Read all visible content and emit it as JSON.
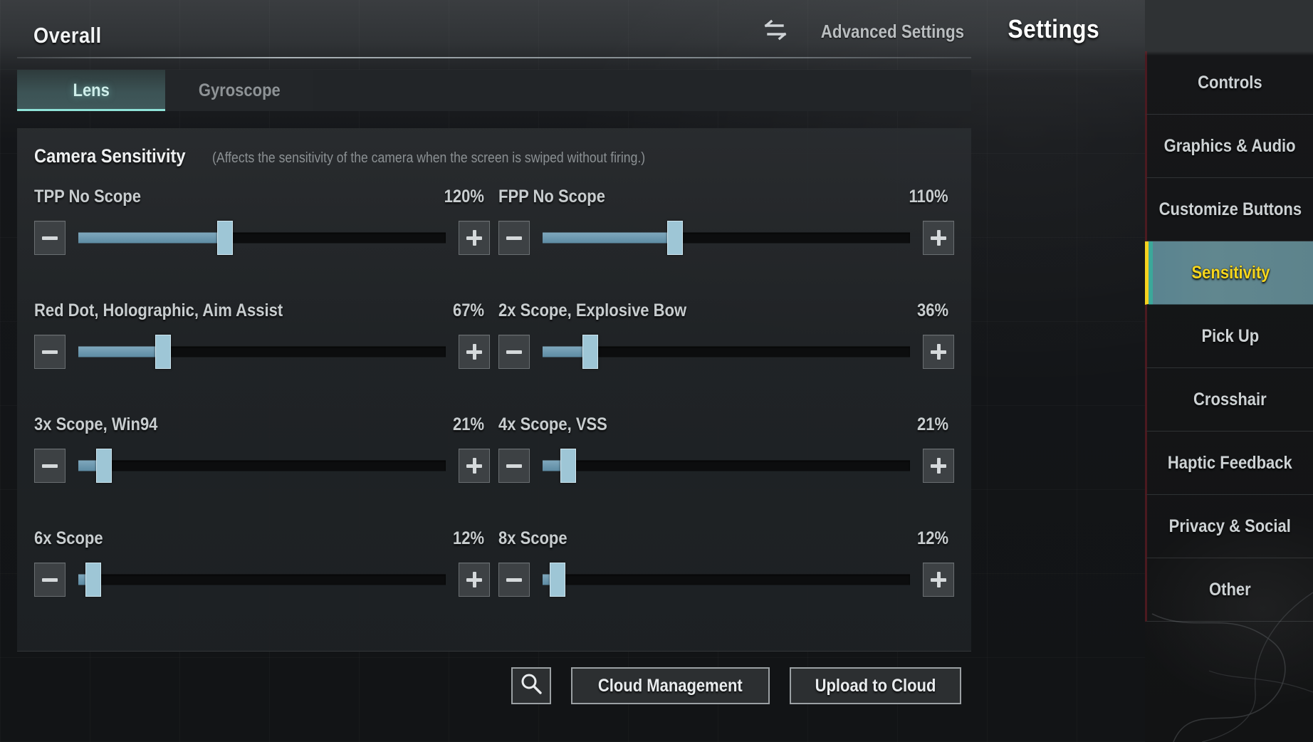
{
  "header": {
    "overall_label": "Overall",
    "advanced_settings_label": "Advanced Settings",
    "advanced_settings_icon": "swap-arrows-icon",
    "settings_title": "Settings",
    "close_icon": "close-icon"
  },
  "tabs": [
    {
      "label": "Lens",
      "active": true
    },
    {
      "label": "Gyroscope",
      "active": false
    }
  ],
  "section": {
    "title": "Camera Sensitivity",
    "description": "(Affects the sensitivity of the camera when the screen is swiped without firing.)"
  },
  "sliders": [
    {
      "name": "TPP No Scope",
      "value": "120%",
      "percent": 40
    },
    {
      "name": "FPP No Scope",
      "value": "110%",
      "percent": 36
    },
    {
      "name": "Red Dot, Holographic, Aim Assist",
      "value": "67%",
      "percent": 23
    },
    {
      "name": "2x Scope, Explosive Bow",
      "value": "36%",
      "percent": 13
    },
    {
      "name": "3x Scope, Win94",
      "value": "21%",
      "percent": 7
    },
    {
      "name": "4x Scope, VSS",
      "value": "21%",
      "percent": 7
    },
    {
      "name": "6x Scope",
      "value": "12%",
      "percent": 4
    },
    {
      "name": "8x Scope",
      "value": "12%",
      "percent": 4
    }
  ],
  "stepper": {
    "minus_icon": "minus-icon",
    "plus_icon": "plus-icon"
  },
  "bottom_buttons": {
    "search_icon": "search-icon",
    "cloud_management_label": "Cloud Management",
    "upload_to_cloud_label": "Upload to Cloud"
  },
  "sidebar": {
    "items": [
      {
        "label": "Controls",
        "active": false
      },
      {
        "label": "Graphics & Audio",
        "active": false
      },
      {
        "label": "Customize Buttons",
        "active": false
      },
      {
        "label": "Sensitivity",
        "active": true
      },
      {
        "label": "Pick Up",
        "active": false
      },
      {
        "label": "Crosshair",
        "active": false
      },
      {
        "label": "Haptic Feedback",
        "active": false
      },
      {
        "label": "Privacy & Social",
        "active": false
      },
      {
        "label": "Other",
        "active": false
      }
    ]
  },
  "colors": {
    "accent_teal": "#8fe3d8",
    "active_yellow": "#f7d71e",
    "slider_blue": "#6d9cb4",
    "knob_blue": "#9ec6d6"
  }
}
